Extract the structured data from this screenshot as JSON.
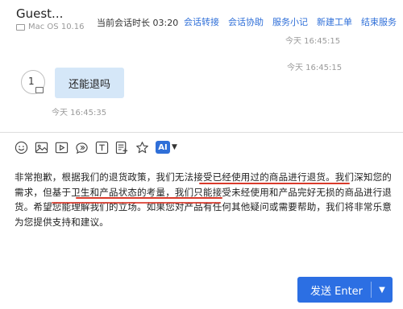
{
  "header": {
    "guest_name": "Guest...",
    "guest_sub": "Mac OS 10.16",
    "session_time": "当前会话时长 03:20",
    "actions": [
      "会话转接",
      "会话协助",
      "服务小记",
      "新建工单",
      "结束服务"
    ]
  },
  "chat": {
    "ts_top": "今天 16:45:15",
    "ts_mid": "今天 16:45:15",
    "avatar_number": "1",
    "message": "还能退吗",
    "message_time": "今天 16:45:35"
  },
  "toolbar": {
    "icons": [
      "smile-icon",
      "image-icon",
      "video-icon",
      "quick-reply-icon",
      "text-template-icon",
      "form-icon",
      "star-icon",
      "ai-icon"
    ],
    "ai_label": "AI"
  },
  "editor": {
    "text": "非常抱歉，根据我们的退货政策，我们无法接受已经使用过的商品进行退货。我们深知您的需求，但基于卫生和产品状态的考量，我们只能接受未经使用和产品完好无损的商品进行退货。希望您能理解我们的立场。如果您对产品有任何其他疑问或需要帮助，我们将非常乐意为您提供支持和建议。"
  },
  "send": {
    "label": "发送 Enter"
  },
  "colors": {
    "accent": "#2c6fe3",
    "link": "#2f6fd8",
    "bubble": "#d5e7f8",
    "underline": "#d93a2b"
  }
}
